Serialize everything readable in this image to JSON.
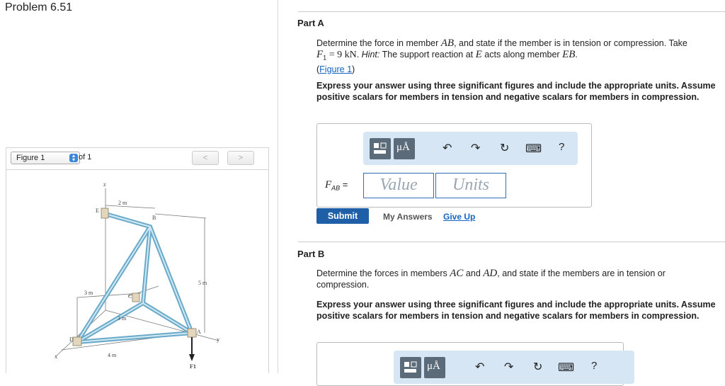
{
  "problem": {
    "title": "Problem 6.51"
  },
  "figure": {
    "select_value": "Figure 1",
    "of_label": "of 1",
    "prev_label": "<",
    "next_label": ">",
    "labels": {
      "z": "z",
      "two_m": "2 m",
      "E": "E",
      "B": "B",
      "five_m": "5 m",
      "three_m_left": "3 m",
      "C": "C",
      "three_m_mid": "3 m",
      "A": "A",
      "y": "y",
      "D": "D",
      "four_m": "4 m",
      "x": "x",
      "F1": "F1"
    }
  },
  "partA": {
    "title": "Part A",
    "prompt_1": "Determine the force in member ",
    "prompt_member": "AB",
    "prompt_2": ", and state if the member is in tension or compression. Take",
    "prompt_F": "F",
    "prompt_F_sub": "1",
    "prompt_F_value": " = 9 kN",
    "prompt_hint_label": "Hint:",
    "prompt_hint_1": " The support reaction at ",
    "prompt_hint_E": "E",
    "prompt_hint_2": " acts along member ",
    "prompt_hint_EB": "EB",
    "prompt_hint_end": ".",
    "figure_link_open": "(",
    "figure_link": "Figure 1",
    "figure_link_close": ")",
    "instructions": "Express your answer using three significant figures and include the appropriate units. Assume positive scalars for members in tension and negative scalars for members in compression.",
    "answer_label_F": "F",
    "answer_label_sub": "AB",
    "answer_label_eq": " =",
    "value_placeholder": "Value",
    "units_placeholder": "Units",
    "submit_label": "Submit",
    "my_answers_label": "My Answers",
    "give_up_label": "Give Up"
  },
  "partB": {
    "title": "Part B",
    "prompt_1": "Determine the forces in members ",
    "prompt_AC": "AC",
    "prompt_and": " and ",
    "prompt_AD": "AD",
    "prompt_2": ", and state if the members are in tension or compression.",
    "instructions": "Express your answer using three significant figures and include the appropriate units. Assume positive scalars for members in tension and negative scalars for members in compression."
  },
  "toolbar": {
    "units_symbol": "μÅ",
    "help_label": "?",
    "icons": [
      "templates-icon",
      "units-icon",
      "undo-icon",
      "redo-icon",
      "reset-icon",
      "keyboard-icon",
      "help-icon"
    ]
  },
  "colors": {
    "link": "#1565c0",
    "submit": "#1f5fa8",
    "toolbar_bg": "#d6e6f5",
    "field_border": "#2f6fb8",
    "truss": "#8fc3dc"
  }
}
